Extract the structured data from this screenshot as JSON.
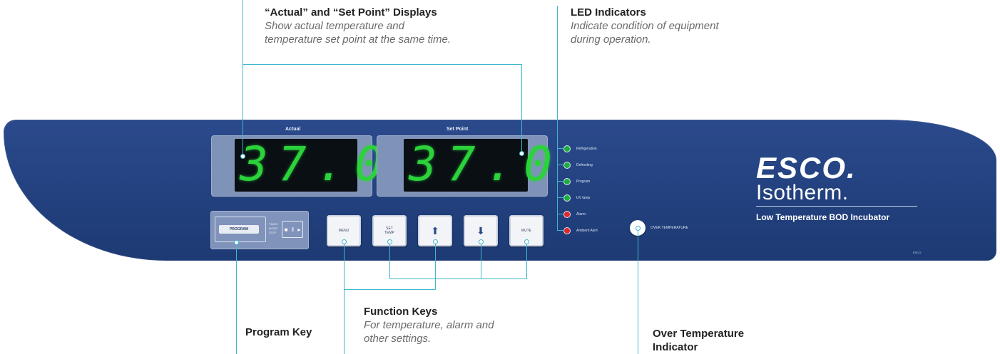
{
  "callouts": {
    "displays": {
      "title": "“Actual” and “Set Point” Displays",
      "desc_line1": "Show actual temperature and",
      "desc_line2": "temperature set point at the same time."
    },
    "leds": {
      "title": "LED Indicators",
      "desc_line1": "Indicate condition of equipment",
      "desc_line2": "during operation."
    },
    "function_keys": {
      "title": "Function Keys",
      "desc_line1": "For temperature, alarm and",
      "desc_line2": "other settings."
    },
    "program_key": {
      "title": "Program Key"
    },
    "over_temp": {
      "title_line1": "Over Temperature",
      "title_line2": "Indicator"
    }
  },
  "panel": {
    "actual_label": "Actual",
    "actual_value": "37.0",
    "setpoint_label": "Set Point",
    "setpoint_value": "37.0",
    "leds": [
      {
        "label": "Refrigeration",
        "color": "green"
      },
      {
        "label": "Defrosting",
        "color": "green"
      },
      {
        "label": "Program",
        "color": "green"
      },
      {
        "label": "UV lamp",
        "color": "green"
      },
      {
        "label": "Alarm",
        "color": "red"
      },
      {
        "label": "Ambient Alert",
        "color": "red"
      }
    ],
    "program": {
      "button": "PROGRAM",
      "side_1": "TIMER",
      "side_2": "MODE",
      "side_3": "STEP"
    },
    "keys": {
      "menu": "MENU",
      "set_temp_1": "SET",
      "set_temp_2": "TEMP",
      "up": "⬆",
      "down": "⬇",
      "mute": "MUTE"
    },
    "over_temperature_label": "OVER TEMPERATURE",
    "brand": {
      "logo": "ESCO.",
      "product": "Isotherm.",
      "description": "Low Temperature BOD Incubator",
      "mark": "ESCO"
    }
  },
  "colors": {
    "panel": "#22407d",
    "callout_line": "#3fb6cf",
    "led_green": "#1fae3e",
    "led_red": "#e2262b",
    "digit": "#2bd23a"
  }
}
